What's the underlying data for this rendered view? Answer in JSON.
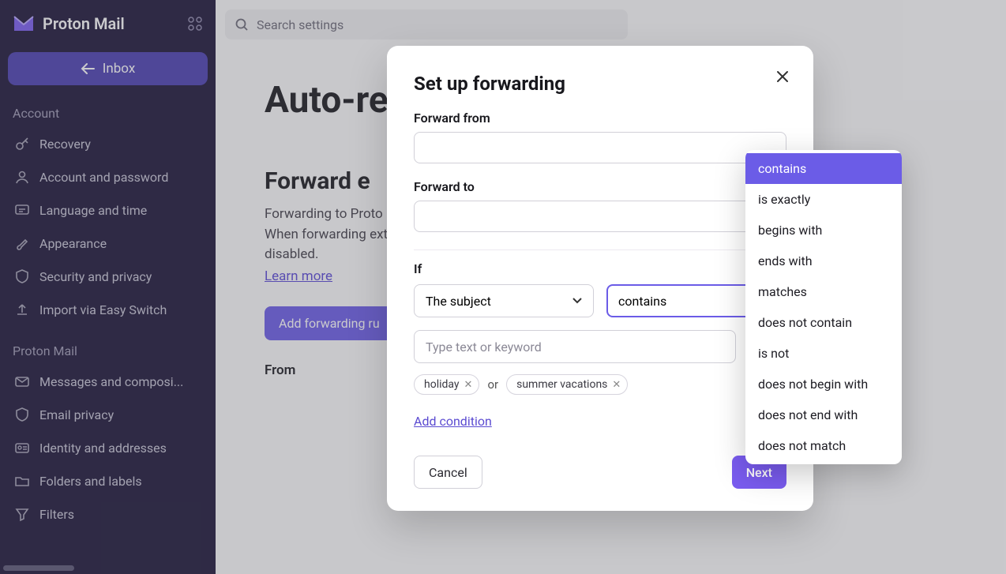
{
  "brand": {
    "name": "Proton Mail"
  },
  "inbox_button": "Inbox",
  "sidebar": {
    "section1": "Account",
    "section2": "Proton Mail",
    "items_account": [
      {
        "label": "Recovery"
      },
      {
        "label": "Account and password"
      },
      {
        "label": "Language and time"
      },
      {
        "label": "Appearance"
      },
      {
        "label": "Security and privacy"
      },
      {
        "label": "Import via Easy Switch"
      }
    ],
    "items_mail": [
      {
        "label": "Messages and composi..."
      },
      {
        "label": "Email privacy"
      },
      {
        "label": "Identity and addresses"
      },
      {
        "label": "Folders and labels"
      },
      {
        "label": "Filters"
      }
    ]
  },
  "search": {
    "placeholder": "Search settings"
  },
  "page": {
    "h1": "Auto-re",
    "h2": "Forward e",
    "desc1": "Forwarding to Proto",
    "desc2": "When forwarding ext",
    "desc3": "disabled.",
    "learn": "Learn more",
    "add_rule": "Add forwarding ru",
    "table": {
      "from": "From"
    }
  },
  "modal": {
    "title": "Set up forwarding",
    "forward_from": "Forward from",
    "forward_to": "Forward to",
    "if_label": "If",
    "select_field": "The subject",
    "select_op": "contains",
    "keyword_placeholder": "Type text or keyword",
    "chip1": "holiday",
    "chip2": "summer vacations",
    "or": "or",
    "add_condition": "Add condition",
    "cancel": "Cancel",
    "next": "Next"
  },
  "menu": {
    "items": [
      "contains",
      "is exactly",
      "begins with",
      "ends with",
      "matches",
      "does not contain",
      "is not",
      "does not begin with",
      "does not end with",
      "does not match"
    ]
  }
}
